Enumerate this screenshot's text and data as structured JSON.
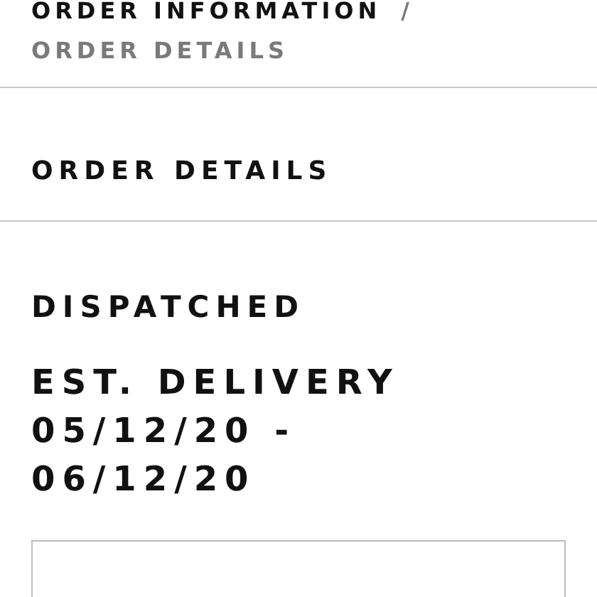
{
  "breadcrumb": [
    {
      "label": "ORDER INFORMATION",
      "current": false
    },
    {
      "label": "ORDER DETAILS",
      "current": true
    }
  ],
  "breadcrumb_separator": "/",
  "heading": "ORDER DETAILS",
  "status": "DISPATCHED",
  "delivery": "EST. DELIVERY 05/12/20 - 06/12/20"
}
